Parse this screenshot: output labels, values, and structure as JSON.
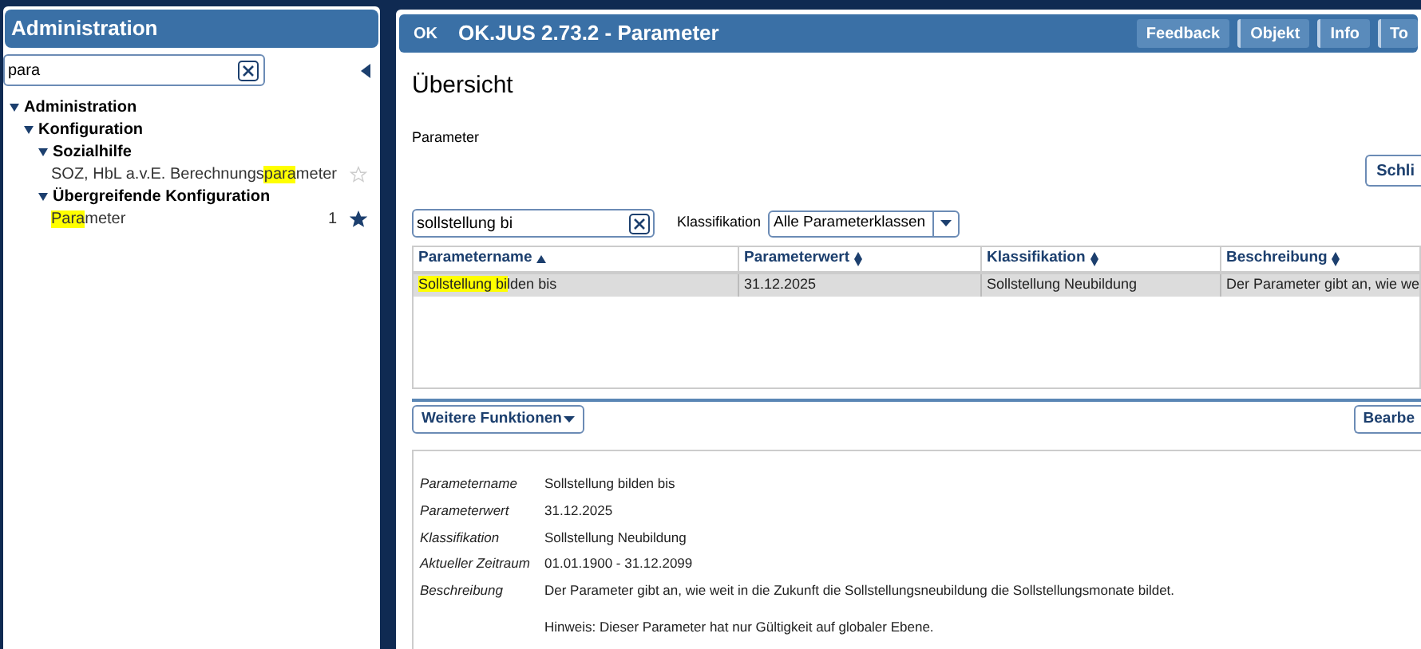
{
  "sidebar": {
    "title": "Administration",
    "search": {
      "value": "para"
    },
    "tree": [
      {
        "label": "Administration",
        "expanded": true,
        "children": [
          {
            "label": "Konfiguration",
            "expanded": true,
            "children": [
              {
                "label": "Sozialhilfe",
                "expanded": true,
                "children": [
                  {
                    "parts": [
                      {
                        "text": "SOZ, HbL a.v.E. Berechnungs",
                        "highlight": false
                      },
                      {
                        "text": "para",
                        "highlight": true
                      },
                      {
                        "text": "meter",
                        "highlight": false
                      }
                    ],
                    "favorite": false
                  }
                ]
              },
              {
                "label": "Übergreifende Konfiguration",
                "expanded": true,
                "children": [
                  {
                    "parts": [
                      {
                        "text": "Para",
                        "highlight": true
                      },
                      {
                        "text": "meter",
                        "highlight": false
                      }
                    ],
                    "count": "1",
                    "favorite": true
                  }
                ]
              }
            ]
          }
        ]
      }
    ]
  },
  "window": {
    "logo": "OK",
    "title": "OK.JUS 2.73.2 - Parameter",
    "buttons": [
      "Feedback",
      "Objekt",
      "Info",
      "To"
    ]
  },
  "heading": "Übersicht",
  "section_label": "Parameter",
  "close_button": "Schli",
  "filter": {
    "search": {
      "value": "sollstellung bi"
    },
    "classification_label": "Klassifikation",
    "classification": {
      "value": "Alle Parameterklassen"
    }
  },
  "table": {
    "columns": [
      {
        "label": "Parametername",
        "sorted": true
      },
      {
        "label": "Parameterwert",
        "sorted": false
      },
      {
        "label": "Klassifikation",
        "sorted": false
      },
      {
        "label": "Beschreibung",
        "sorted": false
      }
    ],
    "rows": [
      {
        "selected": true,
        "cells": [
          {
            "parts": [
              {
                "text": "Sollstellung bi",
                "highlight": true
              },
              {
                "text": "lden bis",
                "highlight": false
              }
            ]
          },
          {
            "parts": [
              {
                "text": "31.12.2025",
                "highlight": false
              }
            ]
          },
          {
            "parts": [
              {
                "text": "Sollstellung Neubildung",
                "highlight": false
              }
            ]
          },
          {
            "parts": [
              {
                "text": "Der Parameter gibt an, wie we",
                "highlight": false
              }
            ]
          }
        ]
      }
    ]
  },
  "more_button": "Weitere Funktionen",
  "edit_button": "Bearbe",
  "details": [
    {
      "label": "Parametername",
      "value": "Sollstellung bilden bis"
    },
    {
      "label": "Parameterwert",
      "value": "31.12.2025"
    },
    {
      "label": "Klassifikation",
      "value": "Sollstellung Neubildung"
    },
    {
      "label": "Aktueller Zeitraum",
      "value": "01.01.1900 - 31.12.2099"
    },
    {
      "label": "Beschreibung",
      "value": "Der Parameter gibt an, wie weit in die Zukunft die Sollstellungsneubildung die Sollstellungsmonate bildet.",
      "note": "Hinweis: Dieser Parameter hat nur Gültigkeit auf globaler Ebene."
    }
  ]
}
